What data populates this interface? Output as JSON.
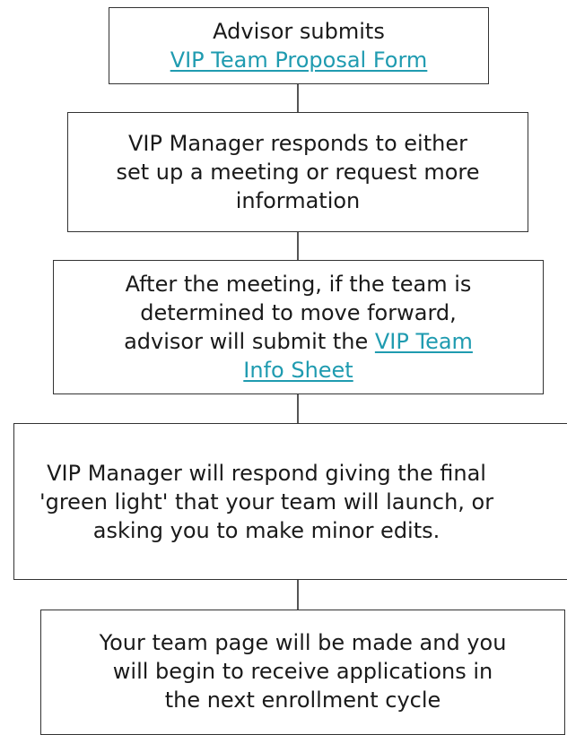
{
  "flow": {
    "step1": {
      "line1": "Advisor submits",
      "link": "VIP Team Proposal Form"
    },
    "step2": {
      "line1": "VIP Manager responds to either",
      "line2": "set up a meeting or request more",
      "line3": "information"
    },
    "step3": {
      "line1": "After the meeting, if the team is",
      "line2": "determined to move forward,",
      "line3_prefix": "advisor will submit the ",
      "link_part1": "VIP Team",
      "link_part2": "Info Sheet"
    },
    "step4": {
      "line1": "VIP Manager will respond giving the final",
      "line2": "'green light' that your team will launch, or",
      "line3": "asking you to make minor edits."
    },
    "step5": {
      "line1": "Your team page will be made and you",
      "line2": "will begin to receive applications in",
      "line3": "the next enrollment cycle"
    }
  },
  "colors": {
    "link": "#1f9bb0",
    "border": "#333333",
    "text": "#1a1a1a"
  }
}
